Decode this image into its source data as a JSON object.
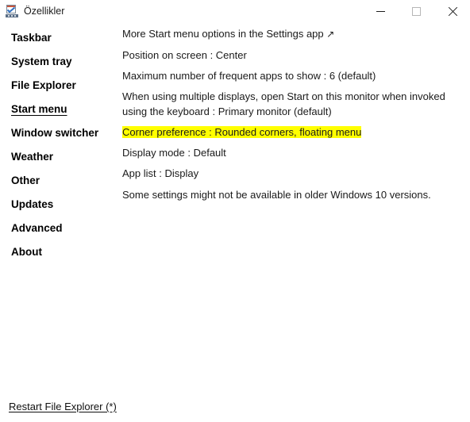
{
  "window": {
    "title": "Özellikler",
    "icon": "properties-window-icon",
    "controls": {
      "minimize": "minimize-button",
      "maximize": "maximize-button",
      "close": "close-button"
    }
  },
  "sidebar": {
    "items": [
      {
        "label": "Taskbar",
        "selected": false
      },
      {
        "label": "System tray",
        "selected": false
      },
      {
        "label": "File Explorer",
        "selected": false
      },
      {
        "label": "Start menu ",
        "selected": true
      },
      {
        "label": "Window switcher",
        "selected": false
      },
      {
        "label": "Weather",
        "selected": false
      },
      {
        "label": "Other",
        "selected": false
      },
      {
        "label": "Updates",
        "selected": false
      },
      {
        "label": "Advanced",
        "selected": false
      },
      {
        "label": "About",
        "selected": false
      }
    ]
  },
  "content": {
    "more_options_label": "More Start menu options in the Settings app",
    "more_options_arrow": "↗",
    "position_on_screen": "Position on screen : Center",
    "max_frequent_apps": "Maximum number of frequent apps to show : 6 (default)",
    "multiple_displays": "When using multiple displays, open Start on this monitor when invoked using the keyboard : Primary monitor (default)",
    "corner_preference": "Corner preference : Rounded corners, floating menu",
    "display_mode": "Display mode : Default",
    "app_list": "App list : Display",
    "note": "Some settings might not be available in older Windows 10 versions."
  },
  "footer": {
    "restart_link": "Restart File Explorer (*)"
  },
  "colors": {
    "highlight": "#FFFF00",
    "window_background": "#FFFFFF",
    "text": "#1A1A1A"
  }
}
